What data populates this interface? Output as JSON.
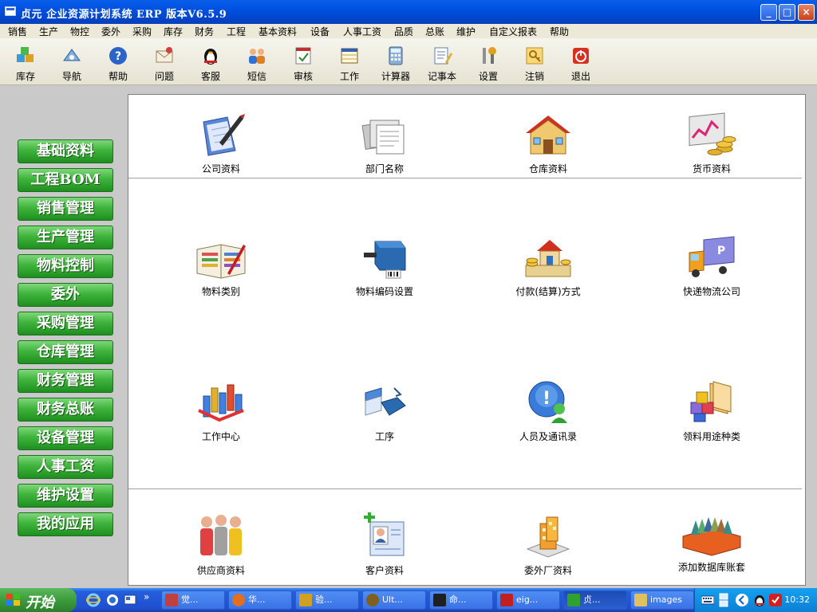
{
  "window": {
    "title": "贞元 企业资源计划系统 ERP 版本V6.5.9",
    "min_symbol": "_",
    "max_symbol": "□",
    "close_symbol": "×"
  },
  "menu": [
    {
      "label": "销售"
    },
    {
      "label": "生产"
    },
    {
      "label": "物控"
    },
    {
      "label": "委外"
    },
    {
      "label": "采购"
    },
    {
      "label": "库存"
    },
    {
      "label": "财务"
    },
    {
      "label": "工程"
    },
    {
      "label": "基本资料"
    },
    {
      "label": "设备"
    },
    {
      "label": "人事工资"
    },
    {
      "label": "品质"
    },
    {
      "label": "总账"
    },
    {
      "label": "维护"
    },
    {
      "label": "自定义报表"
    },
    {
      "label": "帮助"
    }
  ],
  "toolbar": [
    {
      "label": "库存",
      "icon": "boxes-icon"
    },
    {
      "label": "导航",
      "icon": "navigation-icon"
    },
    {
      "label": "帮助",
      "icon": "help-icon"
    },
    {
      "label": "问题",
      "icon": "question-mail-icon"
    },
    {
      "label": "客服",
      "icon": "qq-penguin-icon"
    },
    {
      "label": "短信",
      "icon": "users-sms-icon"
    },
    {
      "label": "审核",
      "icon": "audit-calendar-icon"
    },
    {
      "label": "工作",
      "icon": "work-calendar-icon"
    },
    {
      "label": "计算器",
      "icon": "calculator-icon"
    },
    {
      "label": "记事本",
      "icon": "notepad-icon"
    },
    {
      "label": "设置",
      "icon": "tools-icon"
    },
    {
      "label": "注销",
      "icon": "key-icon"
    },
    {
      "label": "退出",
      "icon": "power-icon"
    }
  ],
  "sidebar": [
    {
      "label": "基础资料"
    },
    {
      "label": "工程BOM"
    },
    {
      "label": "销售管理"
    },
    {
      "label": "生产管理"
    },
    {
      "label": "物料控制"
    },
    {
      "label": "委外"
    },
    {
      "label": "采购管理"
    },
    {
      "label": "仓库管理"
    },
    {
      "label": "财务管理"
    },
    {
      "label": "财务总账"
    },
    {
      "label": "设备管理"
    },
    {
      "label": "人事工资"
    },
    {
      "label": "维护设置"
    },
    {
      "label": "我的应用"
    }
  ],
  "panel_items": [
    {
      "label": "公司资料",
      "icon": "company-pen-icon"
    },
    {
      "label": "部门名称",
      "icon": "department-papers-icon"
    },
    {
      "label": "仓库资料",
      "icon": "warehouse-house-icon"
    },
    {
      "label": "货币资料",
      "icon": "currency-chart-icon"
    },
    {
      "label": "物料类别",
      "icon": "material-book-icon"
    },
    {
      "label": "物料编码设置",
      "icon": "barcode-machine-icon"
    },
    {
      "label": "付款(结算)方式",
      "icon": "payment-house-money-icon"
    },
    {
      "label": "快递物流公司",
      "icon": "delivery-truck-icon"
    },
    {
      "label": "工作中心",
      "icon": "workcenter-bars-icon"
    },
    {
      "label": "工序",
      "icon": "process-flow-icon"
    },
    {
      "label": "人员及通讯录",
      "icon": "contacts-person-icon"
    },
    {
      "label": "领料用途种类",
      "icon": "materials-cubes-icon"
    },
    {
      "label": "供应商资料",
      "icon": "supplier-people-icon"
    },
    {
      "label": "客户资料",
      "icon": "customer-card-icon"
    },
    {
      "label": "委外厂资料",
      "icon": "outsource-building-icon"
    },
    {
      "label": "添加数据库账套",
      "icon": "database-files-icon"
    }
  ],
  "taskbar": {
    "start_label": "开始",
    "overflow": "»",
    "tasks": [
      {
        "label": "觉...",
        "color": "#c04040"
      },
      {
        "label": "华...",
        "color": "#e07020"
      },
      {
        "label": "验...",
        "color": "#d0a020"
      },
      {
        "label": "Ult...",
        "color": "#806020"
      },
      {
        "label": "命...",
        "color": "#202020"
      },
      {
        "label": "eig...",
        "color": "#c02020"
      },
      {
        "label": "贞...",
        "color": "#30a030"
      },
      {
        "label": "images",
        "color": "#e0c060"
      }
    ],
    "clock": "10:32"
  }
}
